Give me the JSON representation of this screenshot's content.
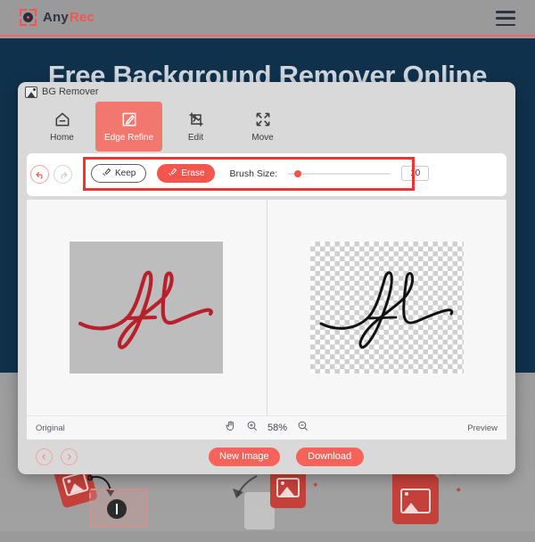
{
  "site": {
    "brand_first": "Any",
    "brand_second": "Rec",
    "brand_mark_icon": "camera-target-icon",
    "menu_icon": "hamburger-menu-icon",
    "hero_title": "Free Background Remover Online",
    "accent_color": "#f4564e",
    "hero_bg_color": "#10314c",
    "header_bg_color": "#9a9a9a"
  },
  "features": [
    {
      "name": "upload-image-feature-icon"
    },
    {
      "name": "remove-background-feature-icon"
    },
    {
      "name": "download-result-feature-icon"
    }
  ],
  "dialog": {
    "title": "BG Remover",
    "app_icon": "bg-remover-app-icon",
    "tabs": [
      {
        "label": "Home",
        "icon": "home-icon",
        "active": false
      },
      {
        "label": "Edge Refine",
        "icon": "pen-edit-square-icon",
        "active": true
      },
      {
        "label": "Edit",
        "icon": "image-crop-icon",
        "active": false
      },
      {
        "label": "Move",
        "icon": "move-arrows-icon",
        "active": false
      }
    ],
    "toolbar": {
      "undo_icon": "undo-arrow-icon",
      "redo_icon": "redo-arrow-icon",
      "undo_enabled": "true",
      "redo_enabled": "false",
      "keep_label": "Keep",
      "keep_icon": "brush-keep-icon",
      "erase_label": "Erase",
      "erase_icon": "brush-erase-icon",
      "active_mode": "Erase",
      "brush_size_label": "Brush Size:",
      "brush_size_value": "10",
      "highlight_color": "#ef3333"
    },
    "canvas": {
      "left_pane_label": "Original",
      "right_pane_label": "Preview",
      "original_bg_color": "#bdbdbd",
      "signature_color_original": "#b8202c",
      "signature_color_cutout": "#121212"
    },
    "statusbar": {
      "original_label": "Original",
      "preview_label": "Preview",
      "hand_icon": "hand-tool-icon",
      "zoom_in_icon": "zoom-in-icon",
      "zoom_out_icon": "zoom-out-icon",
      "zoom_level": "58%"
    },
    "bottombar": {
      "prev_icon": "chevron-left-circle-icon",
      "next_icon": "chevron-right-circle-icon",
      "new_image_label": "New Image",
      "download_label": "Download",
      "button_color": "#f7635b"
    }
  }
}
